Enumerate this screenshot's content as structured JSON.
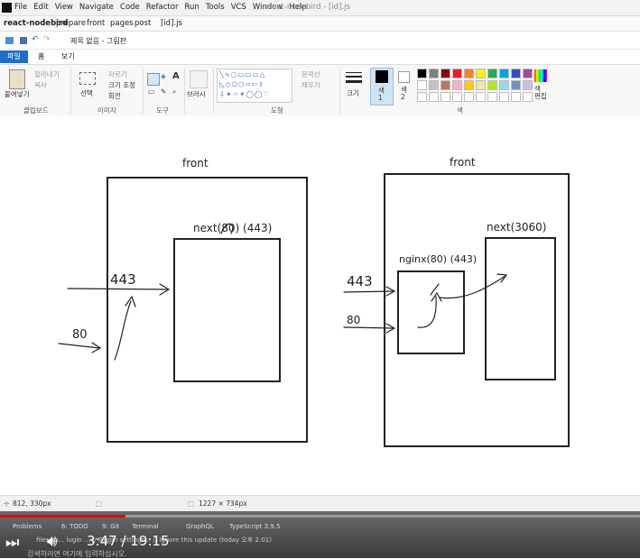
{
  "ide": {
    "menu": [
      "File",
      "Edit",
      "View",
      "Navigate",
      "Code",
      "Refactor",
      "Run",
      "Tools",
      "VCS",
      "Window",
      "Help"
    ],
    "project_file": "react-nodebird - [id].js",
    "breadcrumb": [
      "react-nodebird",
      "prepare",
      "front",
      "pages",
      "post",
      "[id].js"
    ],
    "tool_tabs": [
      "Problems",
      "6: TODO",
      "9: Git",
      "Terminal",
      "GraphQL",
      "TypeScript 3.9.5"
    ],
    "notification": "files su... lugin ... // Plugin settings... // Ignore this update (today 오후 2:01)"
  },
  "paint": {
    "title": "제목 없음 - 그림판",
    "tabs": [
      "파일",
      "홈",
      "보기"
    ],
    "groups": {
      "clipboard": {
        "label": "클립보드",
        "paste": "붙여넣기",
        "cut": "잘라내기",
        "copy": "복사"
      },
      "image": {
        "label": "이미지",
        "select": "선택",
        "crop": "자르기",
        "resize": "크기 조정",
        "rotate": "회전"
      },
      "tools": {
        "label": "도구"
      },
      "brush": {
        "label": "브러시"
      },
      "shapes": {
        "label": "도형",
        "outline": "윤곽선",
        "fill": "채우기"
      },
      "size": {
        "label": "크기"
      },
      "color1": {
        "label": "색\n1"
      },
      "color2": {
        "label": "색\n2"
      },
      "colors": {
        "label": "색",
        "edit": "색\n편집"
      }
    },
    "palette": [
      "#000000",
      "#7f7f7f",
      "#880015",
      "#ed1c24",
      "#ff7f27",
      "#fff200",
      "#22b14c",
      "#00a2e8",
      "#3f48cc",
      "#a349a4",
      "#ffffff",
      "#c3c3c3",
      "#b97a57",
      "#ffaec9",
      "#ffc90e",
      "#efe4b0",
      "#b5e61d",
      "#99d9ea",
      "#7092be",
      "#c8bfe7"
    ],
    "status": {
      "cursor": "812, 330px",
      "canvas_size": "1227 × 734px"
    }
  },
  "canvas": {
    "left_box_label": "front",
    "left_inner_label": "next(80)  (443)",
    "left_443": "443",
    "left_80": "80",
    "right_box_label": "front",
    "nginx_label": "nginx(80)  (443)",
    "right_next_label": "next(3060)",
    "right_443": "443",
    "right_80": "80"
  },
  "video": {
    "time": "3:47 / 19:15",
    "progress": 0.196,
    "search_placeholder": "검색하려면 여기에 입력하십시오."
  }
}
